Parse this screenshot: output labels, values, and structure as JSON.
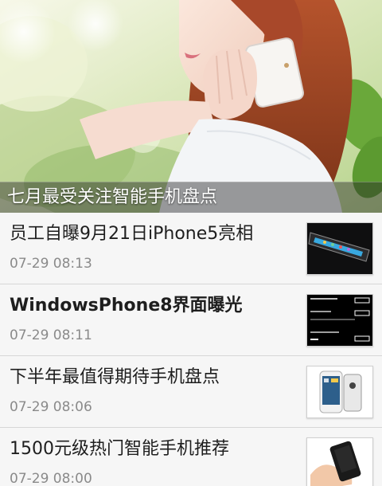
{
  "hero": {
    "caption": "七月最受关注智能手机盘点",
    "image_icon": "woman-on-phone-photo"
  },
  "news": [
    {
      "title": "员工自曝9月21日iPhone5亮相",
      "time": "07-29 08:13",
      "thumb_icon": "black-smartphone-thumbnail"
    },
    {
      "title": "WindowsPhone8界面曝光",
      "time": "07-29 08:11",
      "thumb_icon": "settings-screen-thumbnail"
    },
    {
      "title": "下半年最值得期待手机盘点",
      "time": "07-29 08:06",
      "thumb_icon": "white-htc-phone-thumbnail"
    },
    {
      "title": "1500元级热门智能手机推荐",
      "time": "07-29 08:00",
      "thumb_icon": "phone-in-hand-thumbnail"
    }
  ]
}
